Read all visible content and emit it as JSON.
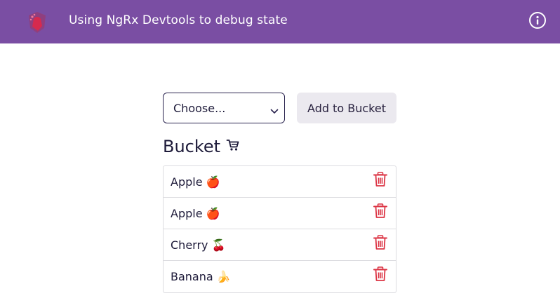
{
  "header": {
    "title": "Using NgRx Devtools to debug state",
    "logo_icon": "ngrx-logo-icon",
    "info_icon": "info-icon",
    "background": "#7a4ea3"
  },
  "controls": {
    "select_value": "Choose...",
    "add_button_label": "Add to Bucket"
  },
  "bucket": {
    "title": "Bucket",
    "cart_icon": "cart-icon",
    "items": [
      {
        "label": "Apple 🍎"
      },
      {
        "label": "Apple 🍎"
      },
      {
        "label": "Cherry 🍒"
      },
      {
        "label": "Banana 🍌"
      }
    ],
    "delete_icon": "trash-icon",
    "delete_color": "#dc3545"
  }
}
